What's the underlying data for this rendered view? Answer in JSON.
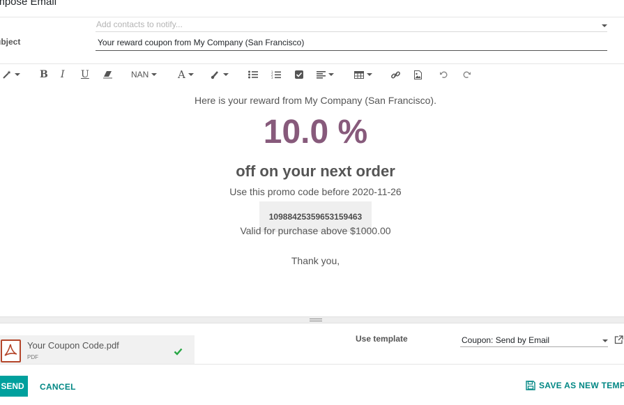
{
  "dialog": {
    "title": "ompose Email"
  },
  "recipients": {
    "placeholder": "Add contacts to notify..."
  },
  "subject": {
    "label": "ubject",
    "value": "Your reward coupon from My Company (San Francisco)"
  },
  "toolbar": {
    "font_size_label": "NAN",
    "buttons": [
      "magic-wand",
      "bold",
      "italic",
      "underline",
      "eraser",
      "font-size",
      "font-color",
      "paint-brush",
      "unordered-list",
      "ordered-list",
      "checklist",
      "align",
      "table",
      "link",
      "image",
      "undo",
      "redo"
    ]
  },
  "email": {
    "intro": "Here is your reward from My Company (San Francisco).",
    "discount": "10.0 %",
    "discount_color": "#875a7b",
    "headline": "off on your next order",
    "validity": "Use this promo code before 2020-11-26",
    "code": "10988425359653159463",
    "minimum": "Valid for purchase above $1000.00",
    "closing": "Thank you,"
  },
  "attachment": {
    "name": "Your Coupon Code.pdf",
    "type": "PDF",
    "status_icon": "check-icon"
  },
  "template": {
    "label": "Use template",
    "value": "Coupon: Send by Email"
  },
  "footer": {
    "send_label": "SEND",
    "cancel_label": "CANCEL",
    "save_template_label": "SAVE AS NEW TEMPI"
  },
  "colors": {
    "primary": "#00a09d",
    "link": "#008784",
    "check": "#28a745"
  }
}
